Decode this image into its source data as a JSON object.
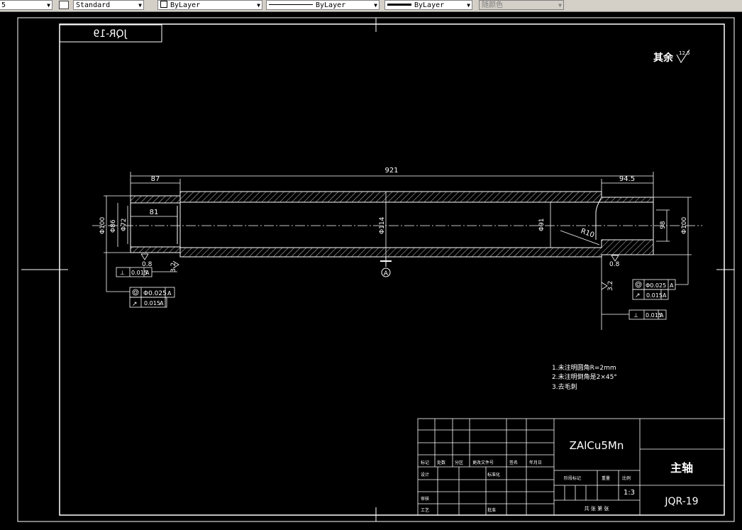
{
  "toolbar": {
    "first_partial": "5",
    "text_style": "Standard",
    "layer": "ByLayer",
    "linetype": "ByLayer",
    "lineweight": "ByLayer",
    "color": "随颜色"
  },
  "drawing": {
    "stamp_mirrored": "JQR-19",
    "roughness_note": "其余",
    "roughness_value": "12.5",
    "dims": {
      "overall": "921",
      "left_len": "87",
      "right_len": "94.5",
      "inner_len": "81",
      "dia_outer_left": "Φ100",
      "dia_86": "Φ86",
      "dia_72": "Φ72",
      "dia_114": "Φ114",
      "dia_91": "Φ91",
      "radius": "R10",
      "dia_98": "98",
      "dia_outer_right": "Φ100",
      "rough_08_left": "0.8",
      "rough_08_right": "0.8",
      "rough_32_left": "3.2",
      "rough_32_right": "3.2",
      "datum": "A"
    },
    "tolerances": {
      "left_perp": "0.015",
      "left_coax": "Φ0.025",
      "left_runout": "0.015",
      "right_coax": "Φ0.025",
      "right_runout": "0.015",
      "right_perp": "0.015",
      "datum_ref": "A"
    },
    "notes": [
      "1.未注明圆角R=2mm",
      "2.未注明倒角是2×45°",
      "3.去毛刺"
    ]
  },
  "title_block": {
    "material": "ZAlCu5Mn",
    "part_name": "主轴",
    "drawing_no": "JQR-19",
    "scale": "1:3",
    "row_labels": [
      "标记",
      "处数",
      "分区",
      "更改文件号",
      "签名",
      "年月日"
    ],
    "design": "设计",
    "standardize": "标准化",
    "stage_mark": "阶段标记",
    "weight": "重量",
    "scale_label": "比例",
    "review": "审核",
    "process": "工艺",
    "approve": "批准",
    "sheets": "共  张  第  张"
  }
}
